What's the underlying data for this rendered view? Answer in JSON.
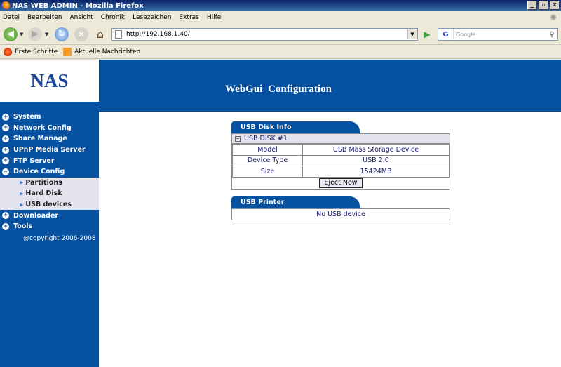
{
  "window": {
    "title": "NAS WEB ADMIN - Mozilla Firefox",
    "buttons": [
      "_",
      "▫",
      "x"
    ]
  },
  "menu": [
    "Datei",
    "Bearbeiten",
    "Ansicht",
    "Chronik",
    "Lesezeichen",
    "Extras",
    "Hilfe"
  ],
  "toolbar": {
    "url": "http://192.168.1.40/",
    "search_placeholder": "Google",
    "search_engine_letter": "G"
  },
  "bookmarks": [
    "Erste Schritte",
    "Aktuelle Nachrichten"
  ],
  "page": {
    "logo": "NAS",
    "header": "WebGui Configuration",
    "nav": [
      {
        "label": "System",
        "expanded": false
      },
      {
        "label": "Network Config",
        "expanded": false
      },
      {
        "label": "Share Manage",
        "expanded": false
      },
      {
        "label": "UPnP Media Server",
        "expanded": false
      },
      {
        "label": "FTP Server",
        "expanded": false
      },
      {
        "label": "Device Config",
        "expanded": true
      }
    ],
    "subnav": [
      "Partitions",
      "Hard Disk",
      "USB devices"
    ],
    "nav_after": [
      {
        "label": "Downloader",
        "expanded": false
      },
      {
        "label": "Tools",
        "expanded": false
      }
    ],
    "copyright": "@copyright 2006-2008",
    "usb_disk": {
      "tab": "USB Disk Info",
      "disk_header": "USB DISK #1",
      "rows": [
        {
          "label": "Model",
          "value": "USB Mass Storage Device"
        },
        {
          "label": "Device Type",
          "value": "USB 2.0"
        },
        {
          "label": "Size",
          "value": "15424MB"
        }
      ],
      "eject_label": "Eject Now"
    },
    "usb_printer": {
      "tab": "USB Printer",
      "message": "No USB device"
    }
  },
  "colors": {
    "brand_blue": "#0752a0",
    "sub_bg": "#e3e3ee",
    "text_navy": "#1a1a6a"
  }
}
